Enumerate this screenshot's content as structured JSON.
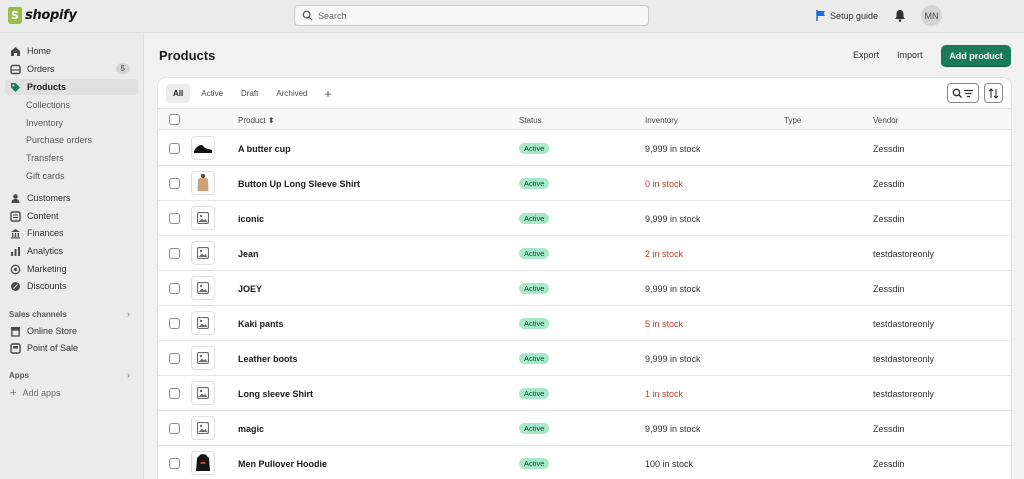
{
  "brand": {
    "name": "shopify",
    "accent": "#95bf47"
  },
  "search": {
    "placeholder": "Search"
  },
  "topbar": {
    "setup_label": "Setup guide",
    "avatar_initials": "MN"
  },
  "sidebar": {
    "items": [
      {
        "label": "Home",
        "icon": "home-icon"
      },
      {
        "label": "Orders",
        "icon": "orders-icon",
        "badge": "5"
      },
      {
        "label": "Products",
        "icon": "tag-icon",
        "active": true
      }
    ],
    "product_sub": [
      "Collections",
      "Inventory",
      "Purchase orders",
      "Transfers",
      "Gift cards"
    ],
    "items2": [
      {
        "label": "Customers",
        "icon": "person-icon"
      },
      {
        "label": "Content",
        "icon": "content-icon"
      },
      {
        "label": "Finances",
        "icon": "bank-icon"
      },
      {
        "label": "Analytics",
        "icon": "chart-icon"
      },
      {
        "label": "Marketing",
        "icon": "target-icon"
      },
      {
        "label": "Discounts",
        "icon": "discount-icon"
      }
    ],
    "sales_channels_heading": "Sales channels",
    "channels": [
      {
        "label": "Online Store",
        "icon": "store-icon"
      },
      {
        "label": "Point of Sale",
        "icon": "pos-icon"
      }
    ],
    "apps_heading": "Apps",
    "add_apps": "Add apps"
  },
  "page": {
    "title": "Products",
    "export_label": "Export",
    "import_label": "Import",
    "add_label": "Add product"
  },
  "tabs": [
    "All",
    "Active",
    "Draft",
    "Archived"
  ],
  "table": {
    "headers": {
      "product": "Product",
      "status": "Status",
      "inventory": "Inventory",
      "type": "Type",
      "vendor": "Vendor"
    },
    "rows": [
      {
        "name": "A butter cup",
        "status": "Active",
        "inventory": "9,999 in stock",
        "low": false,
        "vendor": "Zessdin",
        "thumb": "shoe"
      },
      {
        "name": "Button Up Long Sleeve Shirt",
        "status": "Active",
        "inventory": "0 in stock",
        "low": true,
        "vendor": "Zessdin",
        "thumb": "shirt"
      },
      {
        "name": "iconic",
        "status": "Active",
        "inventory": "9,999 in stock",
        "low": false,
        "vendor": "Zessdin",
        "thumb": "placeholder"
      },
      {
        "name": "Jean",
        "status": "Active",
        "inventory": "2 in stock",
        "low": true,
        "vendor": "testdastoreonly",
        "thumb": "placeholder"
      },
      {
        "name": "JOEY",
        "status": "Active",
        "inventory": "9,999 in stock",
        "low": false,
        "vendor": "Zessdin",
        "thumb": "placeholder"
      },
      {
        "name": "Kaki pants",
        "status": "Active",
        "inventory": "5 in stock",
        "low": true,
        "vendor": "testdastoreonly",
        "thumb": "placeholder"
      },
      {
        "name": "Leather boots",
        "status": "Active",
        "inventory": "9,999 in stock",
        "low": false,
        "vendor": "testdastoreonly",
        "thumb": "placeholder"
      },
      {
        "name": "Long sleeve Shirt",
        "status": "Active",
        "inventory": "1 in stock",
        "low": true,
        "vendor": "testdastoreonly",
        "thumb": "placeholder"
      },
      {
        "name": "magic",
        "status": "Active",
        "inventory": "9,999 in stock",
        "low": false,
        "vendor": "Zessdin",
        "thumb": "placeholder"
      },
      {
        "name": "Men Pullover Hoodie",
        "status": "Active",
        "inventory": "100 in stock",
        "low": false,
        "vendor": "Zessdin",
        "thumb": "hoodie"
      }
    ]
  }
}
